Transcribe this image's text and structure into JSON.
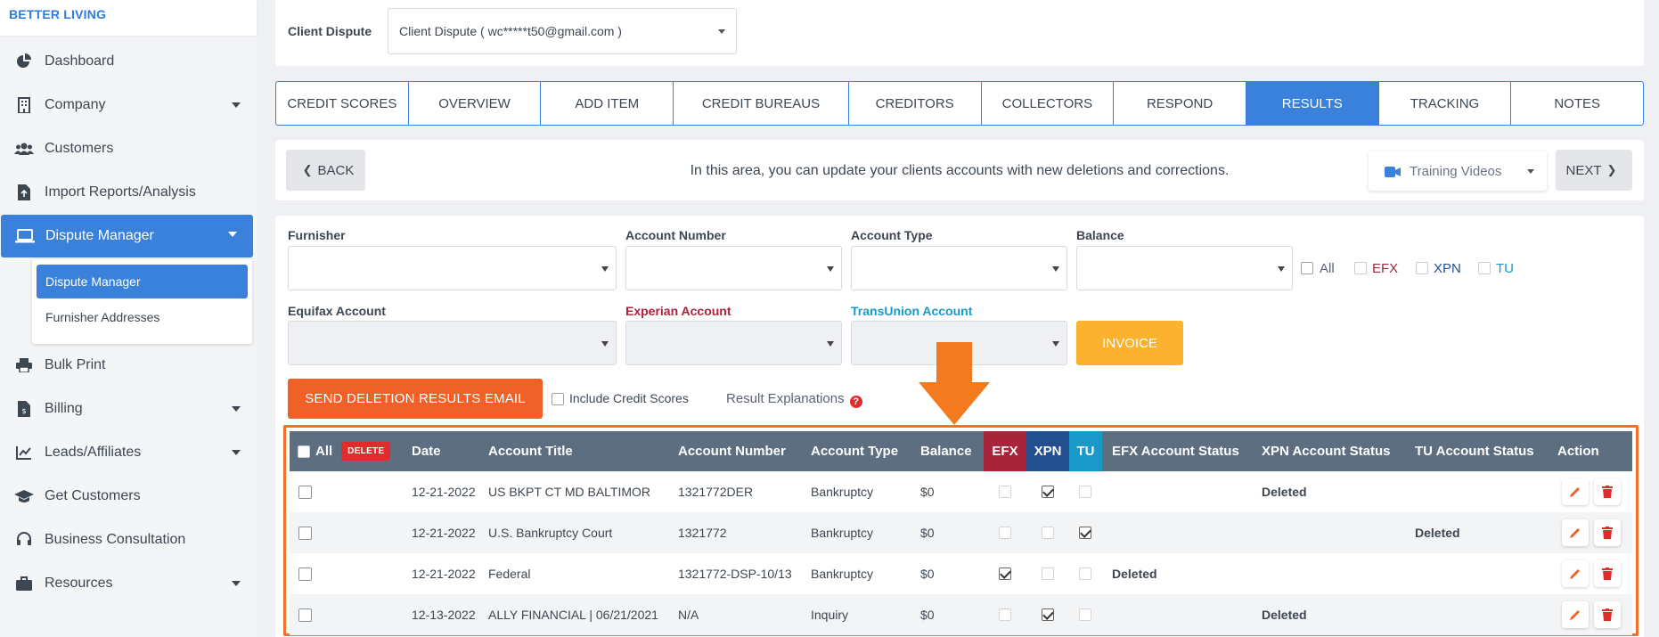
{
  "brand": "BETTER LIVING",
  "sidebar": {
    "items": [
      {
        "label": "Dashboard",
        "icon": "pie-chart-icon"
      },
      {
        "label": "Company",
        "icon": "building-icon",
        "has_caret": true
      },
      {
        "label": "Customers",
        "icon": "users-icon"
      },
      {
        "label": "Import Reports/Analysis",
        "icon": "file-import-icon"
      },
      {
        "label": "Dispute Manager",
        "icon": "laptop-icon",
        "has_caret": true,
        "active": true
      },
      {
        "label": "Bulk Print",
        "icon": "printer-icon"
      },
      {
        "label": "Billing",
        "icon": "invoice-icon",
        "has_caret": true
      },
      {
        "label": "Leads/Affiliates",
        "icon": "line-chart-icon",
        "has_caret": true
      },
      {
        "label": "Get Customers",
        "icon": "graduation-cap-icon"
      },
      {
        "label": "Business Consultation",
        "icon": "headset-icon"
      },
      {
        "label": "Resources",
        "icon": "briefcase-icon",
        "has_caret": true
      }
    ],
    "submenu": [
      "Dispute Manager",
      "Furnisher Addresses"
    ]
  },
  "client_dispute": {
    "label": "Client Dispute",
    "selected": "Client Dispute ( wc*****t50@gmail.com )"
  },
  "tabs": [
    {
      "label": "CREDIT SCORES"
    },
    {
      "label": "OVERVIEW"
    },
    {
      "label": "ADD ITEM"
    },
    {
      "label": "CREDIT BUREAUS"
    },
    {
      "label": "CREDITORS"
    },
    {
      "label": "COLLECTORS"
    },
    {
      "label": "RESPOND"
    },
    {
      "label": "RESULTS",
      "active": true
    },
    {
      "label": "TRACKING"
    },
    {
      "label": "NOTES"
    }
  ],
  "info_bar": {
    "back": "BACK",
    "next": "NEXT",
    "message": "In this area, you can update your clients accounts with new deletions and corrections.",
    "training": "Training Videos"
  },
  "filters": {
    "furnisher": "Furnisher",
    "account_number": "Account Number",
    "account_type": "Account Type",
    "balance": "Balance",
    "all": "All",
    "efx": "EFX",
    "xpn": "XPN",
    "tu": "TU",
    "equifax_account": "Equifax Account",
    "experian_account": "Experian Account",
    "transunion_account": "TransUnion Account",
    "invoice": "INVOICE",
    "send_email": "SEND DELETION RESULTS EMAIL",
    "include_scores": "Include Credit Scores",
    "result_explanations": "Result Explanations"
  },
  "colors": {
    "primary": "#3a81db",
    "efx": "#a8243a",
    "xpn": "#234e8f",
    "tu": "#1899c9",
    "orange": "#f0612a",
    "invoice": "#fbb22e"
  },
  "table": {
    "headers": {
      "all": "All",
      "delete": "DELETE",
      "date": "Date",
      "title": "Account Title",
      "number": "Account Number",
      "type": "Account Type",
      "balance": "Balance",
      "efx": "EFX",
      "xpn": "XPN",
      "tu": "TU",
      "efx_status": "EFX Account Status",
      "xpn_status": "XPN Account Status",
      "tu_status": "TU Account Status",
      "action": "Action"
    },
    "rows": [
      {
        "date": "12-21-2022",
        "title": "US BKPT CT MD BALTIMOR",
        "number": "1321772DER",
        "type": "Bankruptcy",
        "balance": "$0",
        "efx": false,
        "xpn": true,
        "tu": false,
        "efx_status": "",
        "xpn_status": "Deleted",
        "tu_status": ""
      },
      {
        "date": "12-21-2022",
        "title": "U.S. Bankruptcy Court",
        "number": "1321772",
        "type": "Bankruptcy",
        "balance": "$0",
        "efx": false,
        "xpn": false,
        "tu": true,
        "efx_status": "",
        "xpn_status": "",
        "tu_status": "Deleted"
      },
      {
        "date": "12-21-2022",
        "title": "Federal",
        "number": "1321772-DSP-10/13",
        "type": "Bankruptcy",
        "balance": "$0",
        "efx": true,
        "xpn": false,
        "tu": false,
        "efx_status": "Deleted",
        "xpn_status": "",
        "tu_status": ""
      },
      {
        "date": "12-13-2022",
        "title": "ALLY FINANCIAL | 06/21/2021",
        "number": "N/A",
        "type": "Inquiry",
        "balance": "$0",
        "efx": false,
        "xpn": true,
        "tu": false,
        "efx_status": "",
        "xpn_status": "Deleted",
        "tu_status": ""
      }
    ]
  }
}
